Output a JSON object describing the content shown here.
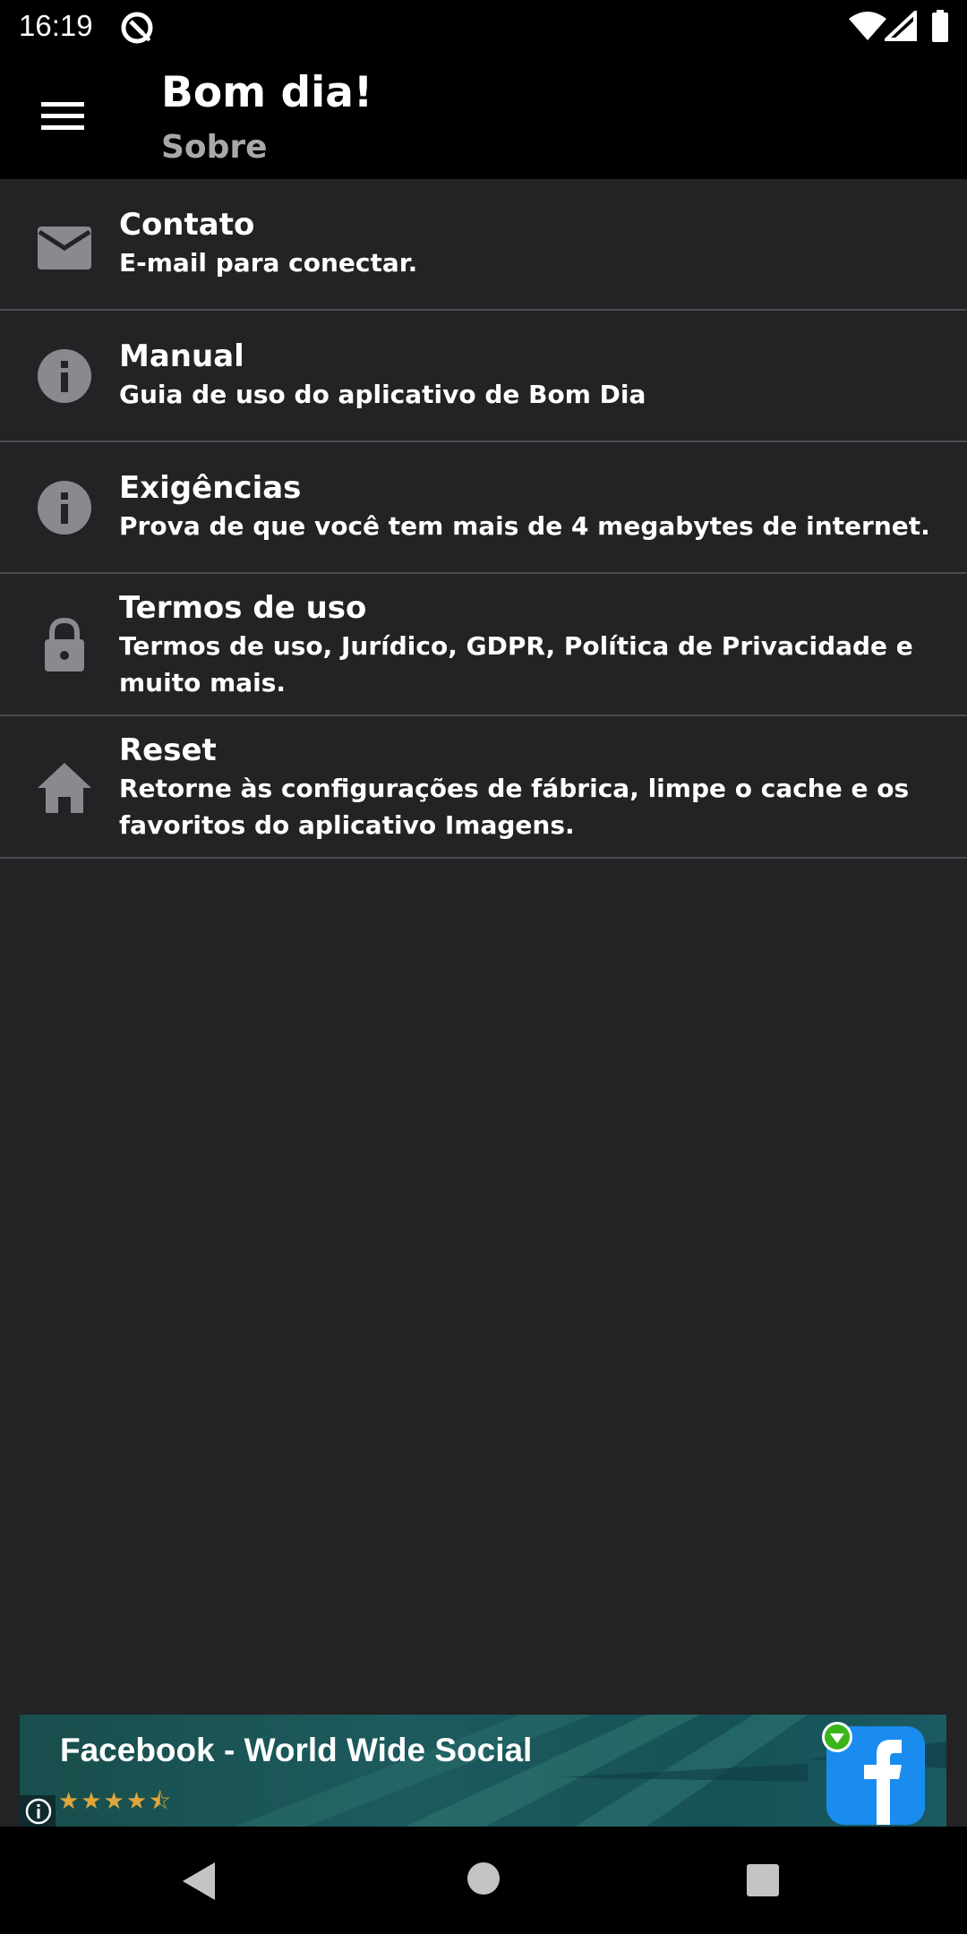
{
  "status_bar": {
    "time": "16:19"
  },
  "app_bar": {
    "title": "Bom dia!",
    "subtitle": "Sobre"
  },
  "list": [
    {
      "title": "Contato",
      "description": "E-mail para conectar.",
      "icon": "mail-icon"
    },
    {
      "title": "Manual",
      "description": "Guia de uso do aplicativo de Bom Dia",
      "icon": "info-icon"
    },
    {
      "title": "Exigências",
      "description": "Prova de que você tem mais de 4 megabytes de internet.",
      "icon": "info-icon"
    },
    {
      "title": "Termos de uso",
      "description": "Termos de uso, Jurídico, GDPR, Política de Privacidade e muito mais.",
      "icon": "lock-icon"
    },
    {
      "title": "Reset",
      "description": "Retorne às configurações de fábrica, limpe o cache e os favoritos do aplicativo Imagens.",
      "icon": "home-icon"
    }
  ],
  "ad": {
    "title": "Facebook - World Wide Social",
    "rating": 4.5,
    "stars_display": "★★★★⯪"
  },
  "colors": {
    "background": "#232225",
    "bar": "#000000",
    "divider": "#4b4a4e",
    "icon": "#8a898d",
    "subtitle": "#a8a8ab"
  }
}
